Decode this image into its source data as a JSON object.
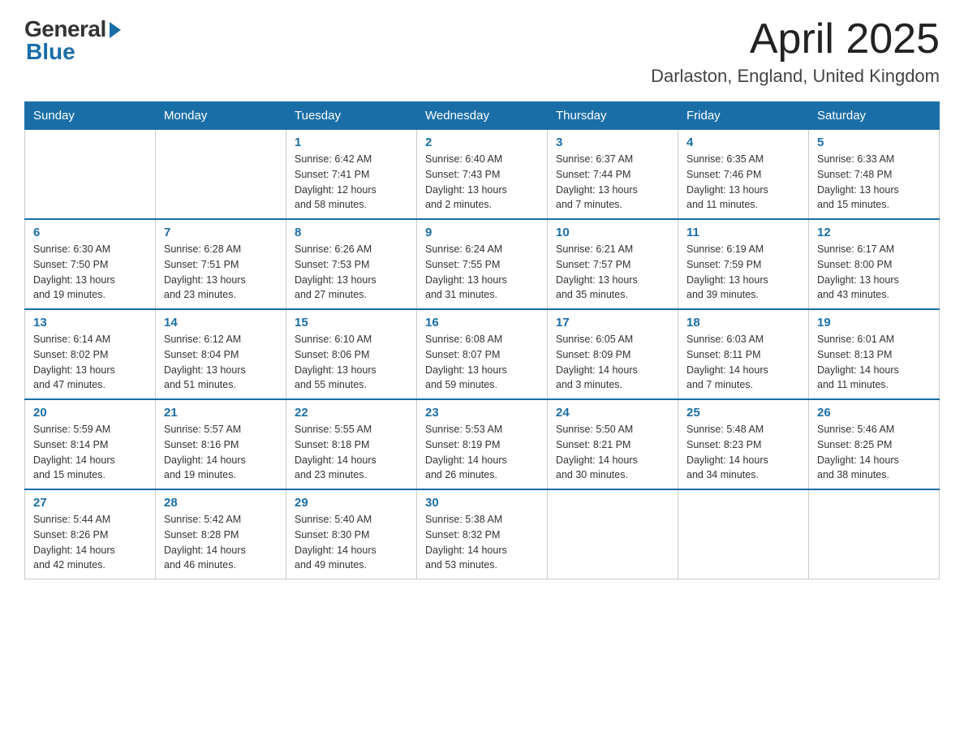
{
  "header": {
    "logo_general": "General",
    "logo_blue": "Blue",
    "month_title": "April 2025",
    "location": "Darlaston, England, United Kingdom"
  },
  "weekdays": [
    "Sunday",
    "Monday",
    "Tuesday",
    "Wednesday",
    "Thursday",
    "Friday",
    "Saturday"
  ],
  "weeks": [
    [
      {
        "day": "",
        "info": ""
      },
      {
        "day": "",
        "info": ""
      },
      {
        "day": "1",
        "info": "Sunrise: 6:42 AM\nSunset: 7:41 PM\nDaylight: 12 hours\nand 58 minutes."
      },
      {
        "day": "2",
        "info": "Sunrise: 6:40 AM\nSunset: 7:43 PM\nDaylight: 13 hours\nand 2 minutes."
      },
      {
        "day": "3",
        "info": "Sunrise: 6:37 AM\nSunset: 7:44 PM\nDaylight: 13 hours\nand 7 minutes."
      },
      {
        "day": "4",
        "info": "Sunrise: 6:35 AM\nSunset: 7:46 PM\nDaylight: 13 hours\nand 11 minutes."
      },
      {
        "day": "5",
        "info": "Sunrise: 6:33 AM\nSunset: 7:48 PM\nDaylight: 13 hours\nand 15 minutes."
      }
    ],
    [
      {
        "day": "6",
        "info": "Sunrise: 6:30 AM\nSunset: 7:50 PM\nDaylight: 13 hours\nand 19 minutes."
      },
      {
        "day": "7",
        "info": "Sunrise: 6:28 AM\nSunset: 7:51 PM\nDaylight: 13 hours\nand 23 minutes."
      },
      {
        "day": "8",
        "info": "Sunrise: 6:26 AM\nSunset: 7:53 PM\nDaylight: 13 hours\nand 27 minutes."
      },
      {
        "day": "9",
        "info": "Sunrise: 6:24 AM\nSunset: 7:55 PM\nDaylight: 13 hours\nand 31 minutes."
      },
      {
        "day": "10",
        "info": "Sunrise: 6:21 AM\nSunset: 7:57 PM\nDaylight: 13 hours\nand 35 minutes."
      },
      {
        "day": "11",
        "info": "Sunrise: 6:19 AM\nSunset: 7:59 PM\nDaylight: 13 hours\nand 39 minutes."
      },
      {
        "day": "12",
        "info": "Sunrise: 6:17 AM\nSunset: 8:00 PM\nDaylight: 13 hours\nand 43 minutes."
      }
    ],
    [
      {
        "day": "13",
        "info": "Sunrise: 6:14 AM\nSunset: 8:02 PM\nDaylight: 13 hours\nand 47 minutes."
      },
      {
        "day": "14",
        "info": "Sunrise: 6:12 AM\nSunset: 8:04 PM\nDaylight: 13 hours\nand 51 minutes."
      },
      {
        "day": "15",
        "info": "Sunrise: 6:10 AM\nSunset: 8:06 PM\nDaylight: 13 hours\nand 55 minutes."
      },
      {
        "day": "16",
        "info": "Sunrise: 6:08 AM\nSunset: 8:07 PM\nDaylight: 13 hours\nand 59 minutes."
      },
      {
        "day": "17",
        "info": "Sunrise: 6:05 AM\nSunset: 8:09 PM\nDaylight: 14 hours\nand 3 minutes."
      },
      {
        "day": "18",
        "info": "Sunrise: 6:03 AM\nSunset: 8:11 PM\nDaylight: 14 hours\nand 7 minutes."
      },
      {
        "day": "19",
        "info": "Sunrise: 6:01 AM\nSunset: 8:13 PM\nDaylight: 14 hours\nand 11 minutes."
      }
    ],
    [
      {
        "day": "20",
        "info": "Sunrise: 5:59 AM\nSunset: 8:14 PM\nDaylight: 14 hours\nand 15 minutes."
      },
      {
        "day": "21",
        "info": "Sunrise: 5:57 AM\nSunset: 8:16 PM\nDaylight: 14 hours\nand 19 minutes."
      },
      {
        "day": "22",
        "info": "Sunrise: 5:55 AM\nSunset: 8:18 PM\nDaylight: 14 hours\nand 23 minutes."
      },
      {
        "day": "23",
        "info": "Sunrise: 5:53 AM\nSunset: 8:19 PM\nDaylight: 14 hours\nand 26 minutes."
      },
      {
        "day": "24",
        "info": "Sunrise: 5:50 AM\nSunset: 8:21 PM\nDaylight: 14 hours\nand 30 minutes."
      },
      {
        "day": "25",
        "info": "Sunrise: 5:48 AM\nSunset: 8:23 PM\nDaylight: 14 hours\nand 34 minutes."
      },
      {
        "day": "26",
        "info": "Sunrise: 5:46 AM\nSunset: 8:25 PM\nDaylight: 14 hours\nand 38 minutes."
      }
    ],
    [
      {
        "day": "27",
        "info": "Sunrise: 5:44 AM\nSunset: 8:26 PM\nDaylight: 14 hours\nand 42 minutes."
      },
      {
        "day": "28",
        "info": "Sunrise: 5:42 AM\nSunset: 8:28 PM\nDaylight: 14 hours\nand 46 minutes."
      },
      {
        "day": "29",
        "info": "Sunrise: 5:40 AM\nSunset: 8:30 PM\nDaylight: 14 hours\nand 49 minutes."
      },
      {
        "day": "30",
        "info": "Sunrise: 5:38 AM\nSunset: 8:32 PM\nDaylight: 14 hours\nand 53 minutes."
      },
      {
        "day": "",
        "info": ""
      },
      {
        "day": "",
        "info": ""
      },
      {
        "day": "",
        "info": ""
      }
    ]
  ]
}
